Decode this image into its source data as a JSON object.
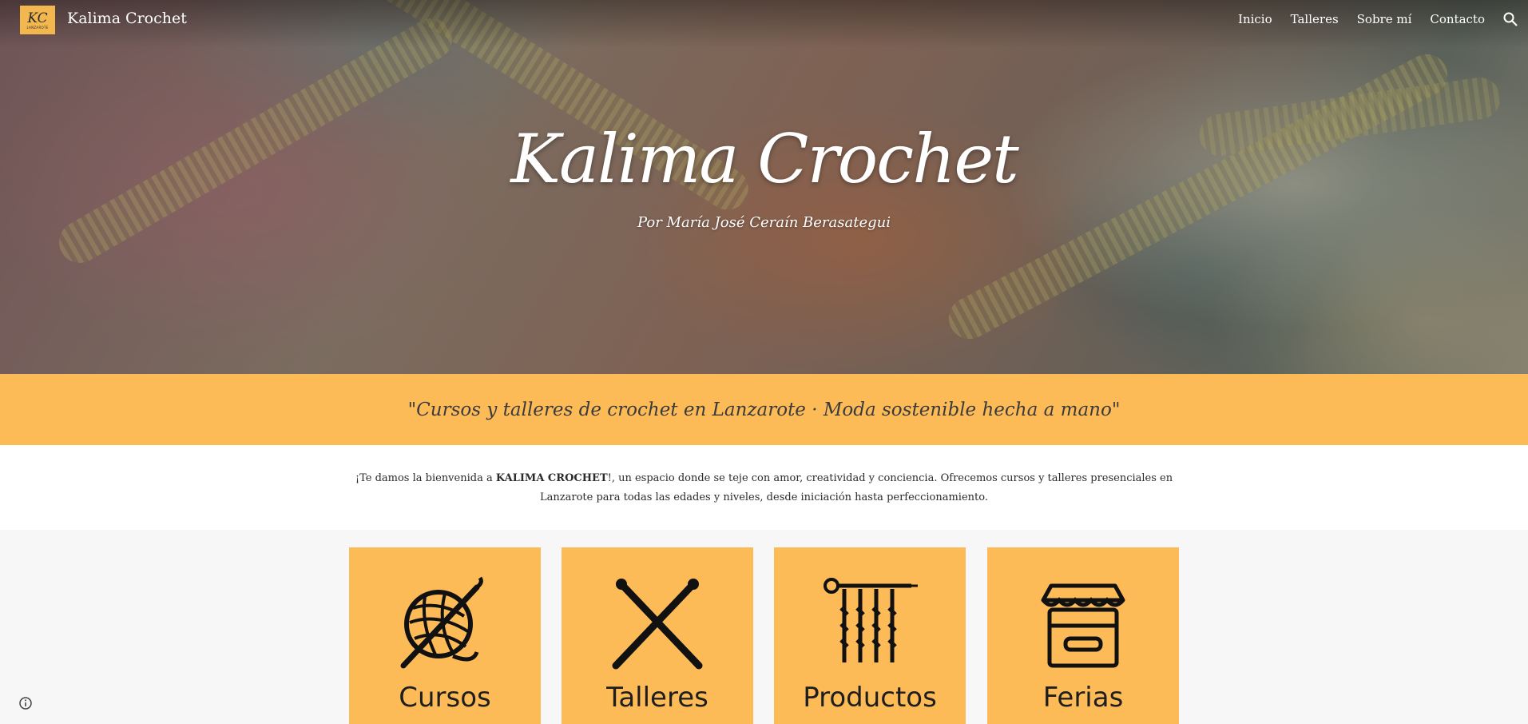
{
  "nav": {
    "logo_mark": "KC",
    "logo_sub": "LANZAROTE",
    "site_name": "Kalima Crochet",
    "links": [
      "Inicio",
      "Talleres",
      "Sobre mí",
      "Contacto"
    ],
    "search_icon": "search-icon"
  },
  "hero": {
    "title": "Kalima Crochet",
    "subtitle": "Por María José Ceraín Berasategui"
  },
  "tagline": "\"Cursos y talleres de crochet en Lanzarote · Moda sostenible hecha a mano\"",
  "intro": {
    "before": "¡Te damos la bienvenida a ",
    "brand": "KALIMA CROCHET",
    "after": "!, un espacio donde se teje con amor, creatividad y conciencia. Ofrecemos cursos y talleres presenciales en Lanzarote para todas las edades y niveles, desde iniciación hasta perfeccionamiento."
  },
  "cards": [
    {
      "label": "Cursos",
      "icon": "yarn-ball-hook-icon"
    },
    {
      "label": "Talleres",
      "icon": "crossed-needles-icon"
    },
    {
      "label": "Productos",
      "icon": "knitting-needle-icon"
    },
    {
      "label": "Ferias",
      "icon": "market-stall-icon"
    }
  ],
  "colors": {
    "accent": "#fdbb58",
    "section_bg": "#f7f7f7",
    "text": "#2b2b2b"
  },
  "footer": {
    "info_icon": "info-icon"
  }
}
